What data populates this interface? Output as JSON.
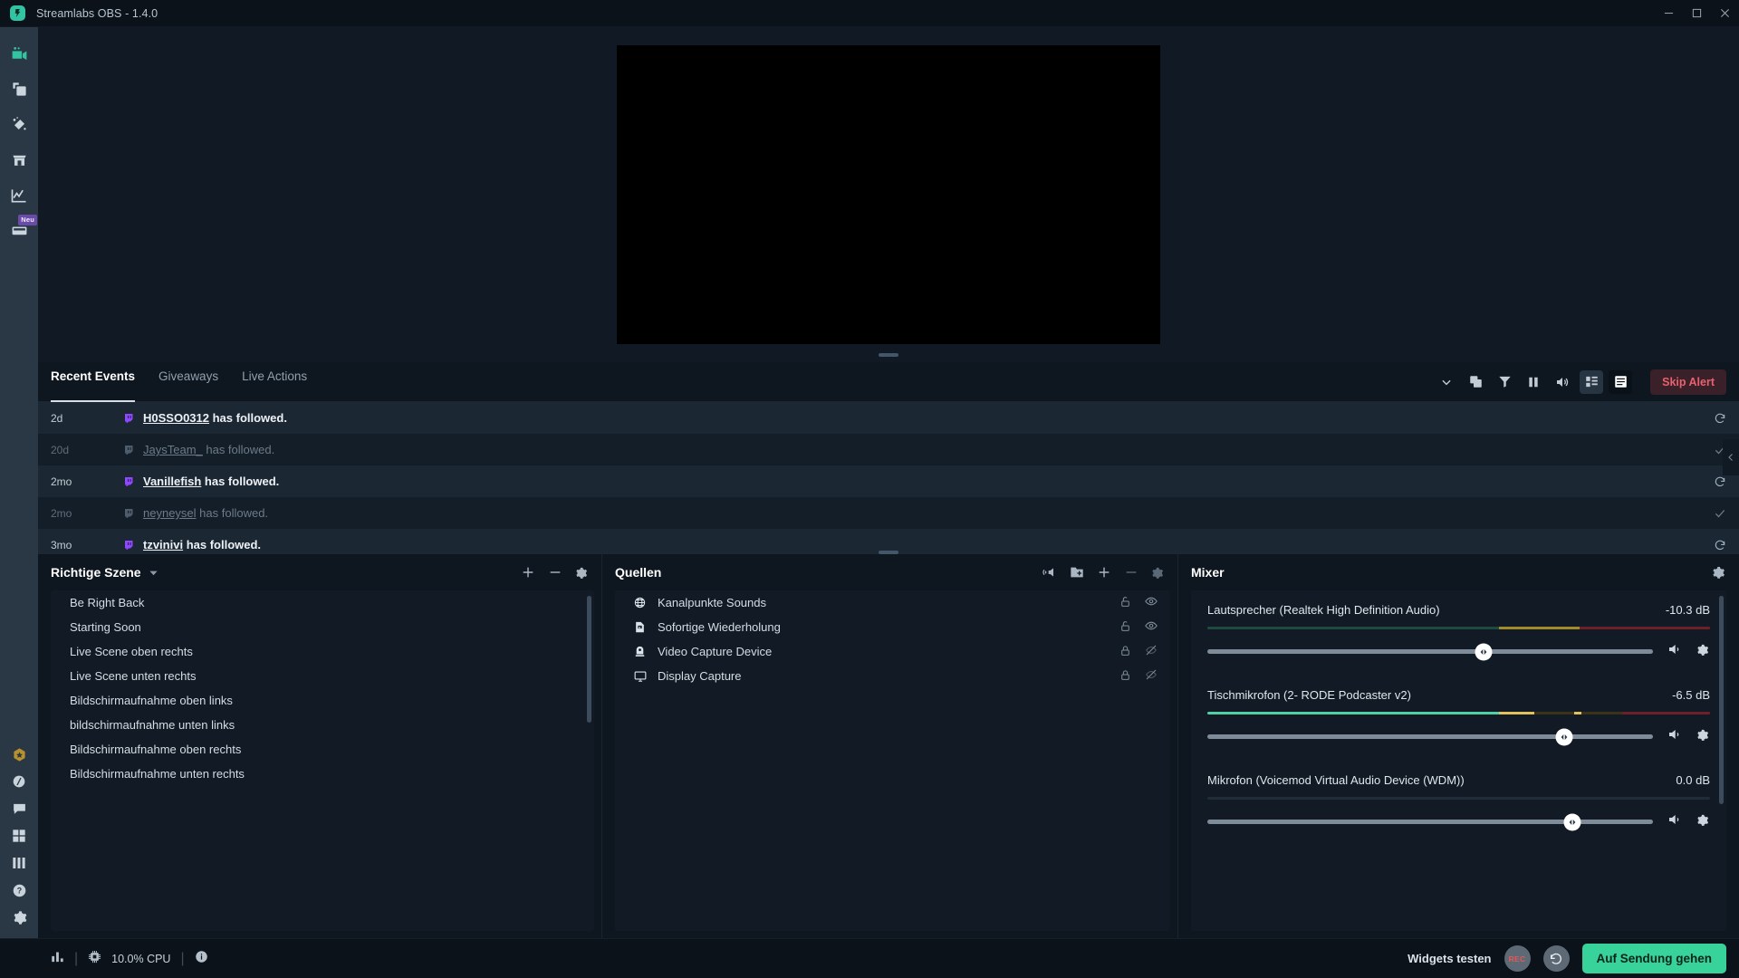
{
  "window": {
    "title": "Streamlabs OBS - 1.4.0",
    "logo_icon": "streamlabs-logo-icon",
    "minimize_icon": "minimize-icon",
    "maximize_icon": "maximize-icon",
    "close_icon": "close-icon"
  },
  "navrail": {
    "items": [
      {
        "name": "editor",
        "icon": "video-camera-icon",
        "active": true,
        "badge": ""
      },
      {
        "name": "layout-editor",
        "icon": "copy-layers-icon",
        "active": false,
        "badge": ""
      },
      {
        "name": "themes",
        "icon": "magic-wand-icon",
        "active": false,
        "badge": ""
      },
      {
        "name": "store",
        "icon": "store-icon",
        "active": false,
        "badge": ""
      },
      {
        "name": "dashboard",
        "icon": "line-chart-icon",
        "active": false,
        "badge": ""
      },
      {
        "name": "highlighter",
        "icon": "film-clip-icon",
        "active": false,
        "badge": "Neu"
      }
    ],
    "bottom_items": [
      {
        "name": "prime",
        "icon": "prime-star-icon"
      },
      {
        "name": "night-mode",
        "icon": "moon-icon"
      },
      {
        "name": "chat",
        "icon": "chat-bubble-icon"
      },
      {
        "name": "apps",
        "icon": "grid-apps-icon"
      },
      {
        "name": "layout",
        "icon": "columns-layout-icon"
      },
      {
        "name": "help",
        "icon": "question-help-icon"
      },
      {
        "name": "settings",
        "icon": "gear-icon"
      }
    ]
  },
  "preview": {
    "name": "stream-preview",
    "resize_handle_icon": "drag-handle-icon"
  },
  "events": {
    "tabs": [
      {
        "label": "Recent Events",
        "active": true
      },
      {
        "label": "Giveaways",
        "active": false
      },
      {
        "label": "Live Actions",
        "active": false
      }
    ],
    "tools": [
      {
        "name": "chevron-down-icon",
        "selected": false
      },
      {
        "name": "duplicate-icon",
        "selected": false
      },
      {
        "name": "filter-icon",
        "selected": false
      },
      {
        "name": "pause-icon",
        "selected": false
      },
      {
        "name": "volume-icon",
        "selected": false
      },
      {
        "name": "grid-view-icon",
        "selected": true
      },
      {
        "name": "list-view-icon",
        "selected": true
      }
    ],
    "skip_alert_label": "Skip Alert",
    "rows": [
      {
        "time": "2d",
        "platform_icon": "twitch-icon",
        "user": "H0SSO0312",
        "text": " has followed.",
        "state": "unread",
        "state_icon": "refresh-icon"
      },
      {
        "time": "20d",
        "platform_icon": "twitch-icon",
        "user": "JaysTeam_",
        "text": " has followed.",
        "state": "read",
        "state_icon": "check-icon"
      },
      {
        "time": "2mo",
        "platform_icon": "twitch-icon",
        "user": "Vanillefish",
        "text": " has followed.",
        "state": "unread",
        "state_icon": "refresh-icon"
      },
      {
        "time": "2mo",
        "platform_icon": "twitch-icon",
        "user": "neyneysel",
        "text": " has followed.",
        "state": "read",
        "state_icon": "check-icon"
      },
      {
        "time": "3mo",
        "platform_icon": "twitch-icon",
        "user": "tzvinivi",
        "text": " has followed.",
        "state": "unread",
        "state_icon": "refresh-icon"
      }
    ]
  },
  "scenes": {
    "title": "Richtige Szene",
    "caret_icon": "caret-down-icon",
    "tools": [
      {
        "name": "add-scene-icon"
      },
      {
        "name": "remove-scene-icon"
      },
      {
        "name": "scene-settings-gear-icon"
      }
    ],
    "items": [
      {
        "label": "Be Right Back"
      },
      {
        "label": "Starting Soon"
      },
      {
        "label": "Live Scene oben rechts"
      },
      {
        "label": "Live Scene unten rechts"
      },
      {
        "label": "Bildschirmaufnahme oben links"
      },
      {
        "label": "bildschirmaufnahme unten links"
      },
      {
        "label": "Bildschirmaufnahme oben rechts"
      },
      {
        "label": "Bildschirmaufnahme unten rechts"
      }
    ]
  },
  "sources": {
    "title": "Quellen",
    "tools": [
      {
        "name": "audio-mixer-icon"
      },
      {
        "name": "add-folder-icon"
      },
      {
        "name": "add-source-icon"
      },
      {
        "name": "remove-source-icon"
      },
      {
        "name": "source-settings-gear-icon"
      }
    ],
    "items": [
      {
        "label": "Kanalpunkte Sounds",
        "icon": "globe-browser-icon",
        "lock_icon": "unlocked-icon",
        "visibility_icon": "eye-visible-icon"
      },
      {
        "label": "Sofortige Wiederholung",
        "icon": "media-file-icon",
        "lock_icon": "unlocked-icon",
        "visibility_icon": "eye-visible-icon"
      },
      {
        "label": "Video Capture Device",
        "icon": "webcam-icon",
        "lock_icon": "locked-icon",
        "visibility_icon": "eye-hidden-icon"
      },
      {
        "label": "Display Capture",
        "icon": "monitor-icon",
        "lock_icon": "locked-icon",
        "visibility_icon": "eye-hidden-icon"
      }
    ]
  },
  "mixer": {
    "title": "Mixer",
    "settings_icon": "gear-icon",
    "channels": [
      {
        "name": "Lautsprecher (Realtek High Definition Audio)",
        "db": "-10.3 dB",
        "meter_green_pct": 58,
        "meter_yellow_pct": 16,
        "meter_peak_pct": 74,
        "volume_pct": 62,
        "mute_icon": "speaker-on-icon",
        "settings_icon": "gear-icon",
        "active": false
      },
      {
        "name": "Tischmikrofon (2- RODE Podcaster v2)",
        "db": "-6.5 dB",
        "meter_green_pct": 58,
        "meter_yellow_pct": 7,
        "meter_peak_pct": 72,
        "volume_pct": 80,
        "mute_icon": "speaker-on-icon",
        "settings_icon": "gear-icon",
        "active": true
      },
      {
        "name": "Mikrofon (Voicemod Virtual Audio Device (WDM))",
        "db": "0.0 dB",
        "meter_green_pct": 0,
        "meter_yellow_pct": 0,
        "meter_peak_pct": 0,
        "volume_pct": 82,
        "mute_icon": "speaker-on-icon",
        "settings_icon": "gear-icon",
        "active": false
      }
    ]
  },
  "collapse": {
    "icon": "chevron-left-icon"
  },
  "statusbar": {
    "stats_icon": "bar-stats-icon",
    "cpu_icon": "cpu-chip-icon",
    "cpu_text": "10.0% CPU",
    "info_icon": "info-circle-icon",
    "widgets_test_label": "Widgets testen",
    "rec_label": "REC",
    "replay_icon": "replay-buffer-icon",
    "go_live_label": "Auf Sendung gehen"
  },
  "colors": {
    "accent_green": "#38d39b",
    "twitch_purple": "#9146ff",
    "skip_alert_red": "#e8616f",
    "badge_purple": "#6b4ba8"
  }
}
